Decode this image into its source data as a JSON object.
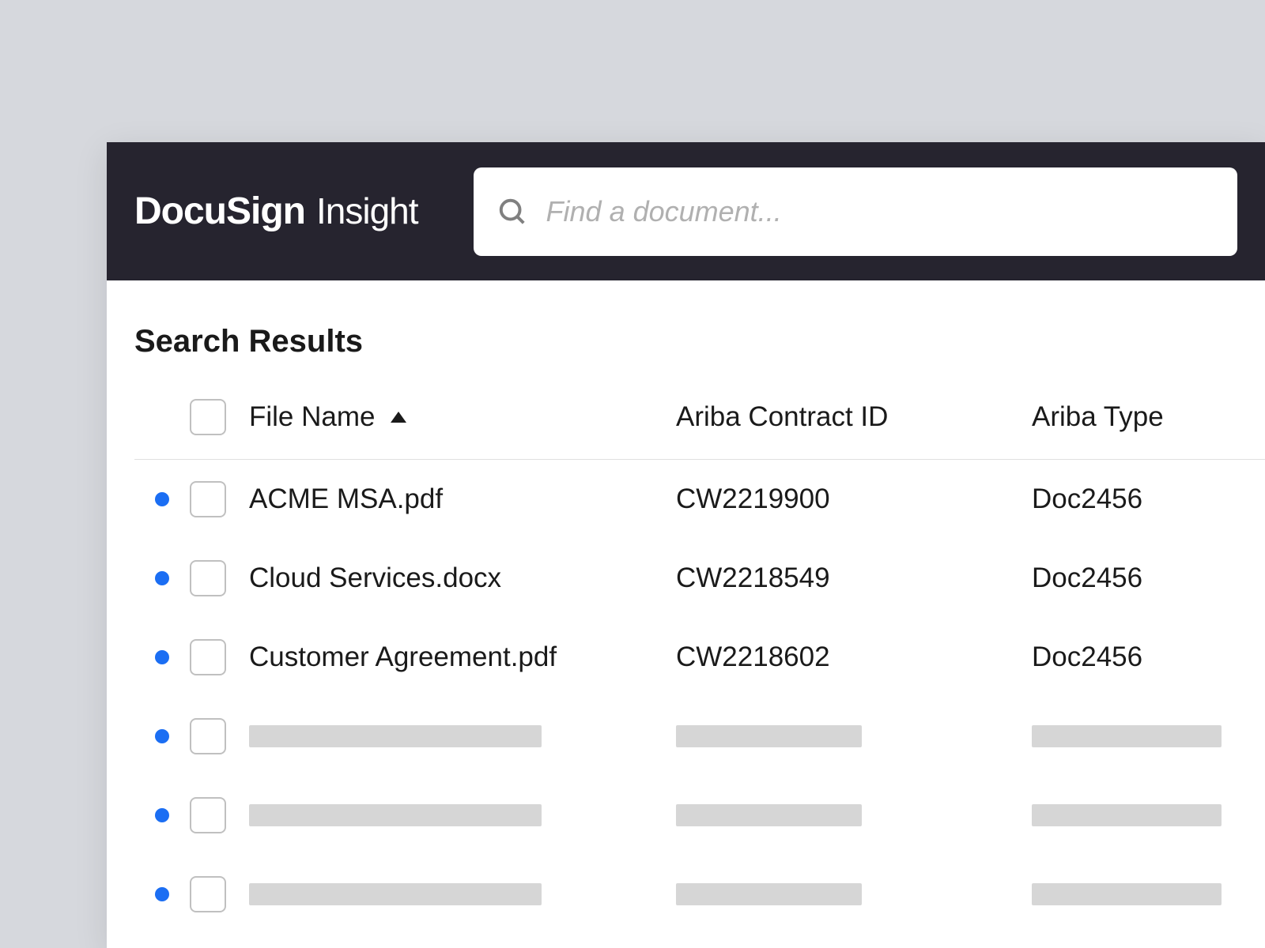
{
  "header": {
    "brand": "DocuSign",
    "product": "Insight",
    "search_placeholder": "Find a document..."
  },
  "content": {
    "section_title": "Search Results",
    "columns": {
      "file_name": "File Name",
      "contract_id": "Ariba Contract ID",
      "ariba_type": "Ariba Type"
    },
    "rows": [
      {
        "file_name": "ACME MSA.pdf",
        "contract_id": "CW2219900",
        "ariba_type": "Doc2456"
      },
      {
        "file_name": "Cloud Services.docx",
        "contract_id": "CW2218549",
        "ariba_type": "Doc2456"
      },
      {
        "file_name": "Customer Agreement.pdf",
        "contract_id": "CW2218602",
        "ariba_type": "Doc2456"
      }
    ],
    "skeleton_rows": 3
  }
}
